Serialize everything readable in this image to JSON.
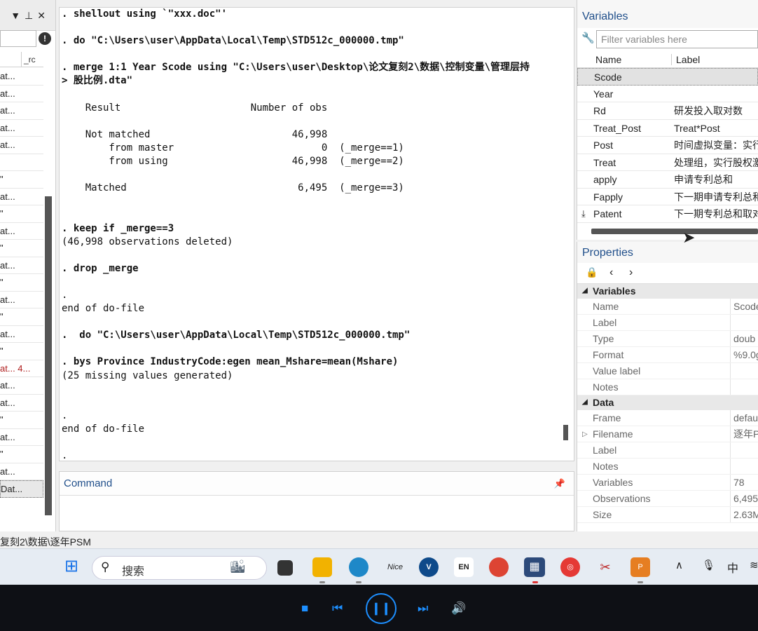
{
  "history": {
    "header_col": "_rc",
    "rows": [
      "at...",
      "at...",
      "at...",
      "at...",
      "at...",
      "",
      "\"",
      "at...",
      "\"",
      "at...",
      "\"",
      "at...",
      "\"",
      "at...",
      "\"",
      "at...",
      "\"",
      "at...  4...",
      "at...",
      "at...",
      "\"",
      "at...",
      "\"",
      "at...",
      "Dat..."
    ]
  },
  "results": {
    "lines": [
      ". shellout using `\"xxx.doc\"'",
      "",
      ". do \"C:\\Users\\user\\AppData\\Local\\Temp\\STD512c_000000.tmp\"",
      "",
      ". merge 1:1 Year Scode using \"C:\\Users\\user\\Desktop\\论文复刻2\\数据\\控制变量\\管理层持",
      "> 股比例.dta\"",
      "",
      "    Result                      Number of obs",
      "",
      "    Not matched                        46,998",
      "        from master                         0  (_merge==1)",
      "        from using                     46,998  (_merge==2)",
      "",
      "    Matched                             6,495  (_merge==3)",
      "",
      "",
      ". keep if _merge==3",
      "(46,998 observations deleted)",
      "",
      ". drop _merge",
      "",
      ".",
      "end of do-file",
      "",
      ".  do \"C:\\Users\\user\\AppData\\Local\\Temp\\STD512c_000000.tmp\"",
      "",
      ". bys Province IndustryCode:egen mean_Mshare=mean(Mshare)",
      "(25 missing values generated)",
      "",
      "",
      ".",
      "end of do-file",
      "",
      "."
    ]
  },
  "command": {
    "title": "Command"
  },
  "variables": {
    "title": "Variables",
    "filter_placeholder": "Filter variables here",
    "col_name": "Name",
    "col_label": "Label",
    "rows": [
      {
        "name": "Scode",
        "label": ""
      },
      {
        "name": "Year",
        "label": ""
      },
      {
        "name": "Rd",
        "label": "研发投入取对数"
      },
      {
        "name": "Treat_Post",
        "label": "Treat*Post"
      },
      {
        "name": "Post",
        "label": "时间虚拟变量：实行"
      },
      {
        "name": "Treat",
        "label": "处理组，实行股权激"
      },
      {
        "name": "apply",
        "label": "申请专利总和"
      },
      {
        "name": "Fapply",
        "label": "下一期申请专利总和"
      },
      {
        "name": "Patent",
        "label": "下一期专利总和取对"
      }
    ]
  },
  "properties": {
    "title": "Properties",
    "group_variables": "Variables",
    "var_props": [
      {
        "k": "Name",
        "v": "Scode"
      },
      {
        "k": "Label",
        "v": ""
      },
      {
        "k": "Type",
        "v": "doub"
      },
      {
        "k": "Format",
        "v": "%9.0g"
      },
      {
        "k": "Value label",
        "v": ""
      },
      {
        "k": "Notes",
        "v": ""
      }
    ],
    "group_data": "Data",
    "data_props": [
      {
        "k": "Frame",
        "v": "defau"
      },
      {
        "k": "Filename",
        "v": "逐年P"
      },
      {
        "k": "Label",
        "v": ""
      },
      {
        "k": "Notes",
        "v": ""
      },
      {
        "k": "Variables",
        "v": "78"
      },
      {
        "k": "Observations",
        "v": "6,495"
      },
      {
        "k": "Size",
        "v": "2.63M"
      }
    ]
  },
  "status": {
    "path": "复刻2\\数据\\逐年PSM"
  },
  "taskbar": {
    "search_text": "搜索",
    "ime": "中",
    "en_badge": "EN",
    "nice_label": "Nice"
  }
}
